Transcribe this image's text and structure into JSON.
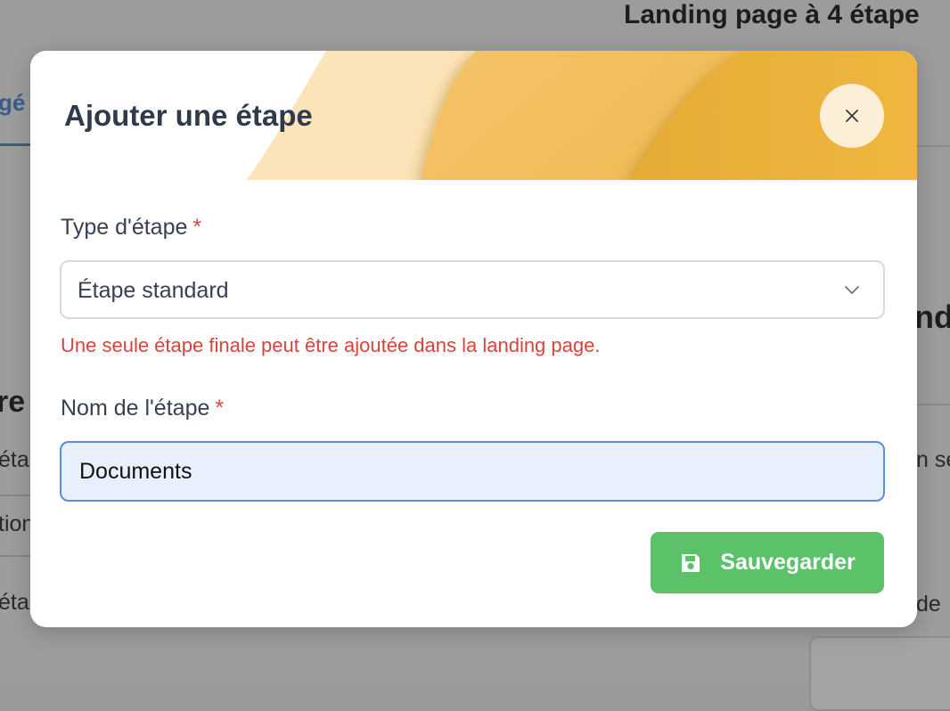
{
  "background": {
    "page_title": "Landing page à 4 étape",
    "tab_label": "gé",
    "left_heading": "re",
    "left_rows": [
      "éta",
      "tion",
      "éta"
    ],
    "right_heading": "nd",
    "right_rows": [
      "n se",
      "de"
    ]
  },
  "modal": {
    "title": "Ajouter une étape",
    "close_label": "Fermer",
    "step_type": {
      "label": "Type d'étape",
      "required_mark": "*",
      "selected_value": "Étape standard",
      "error": "Une seule étape finale peut être ajoutée dans la landing page."
    },
    "step_name": {
      "label": "Nom de l'étape",
      "required_mark": "*",
      "value": "Documents"
    },
    "save_label": "Sauvegarder"
  },
  "icons": {
    "close": "close-icon",
    "chevron": "chevron-down-icon",
    "save": "floppy-disk-icon"
  },
  "colors": {
    "header_light": "#fce4b9",
    "header_mid": "#f2bc58",
    "header_dark": "#ecb23c",
    "close_bg": "#fbf0d7",
    "required": "#e04444",
    "error": "#d8443c",
    "input_focus_border": "#5b8ddb",
    "input_bg": "#e8f0fd",
    "save_button": "#5cc26a"
  }
}
